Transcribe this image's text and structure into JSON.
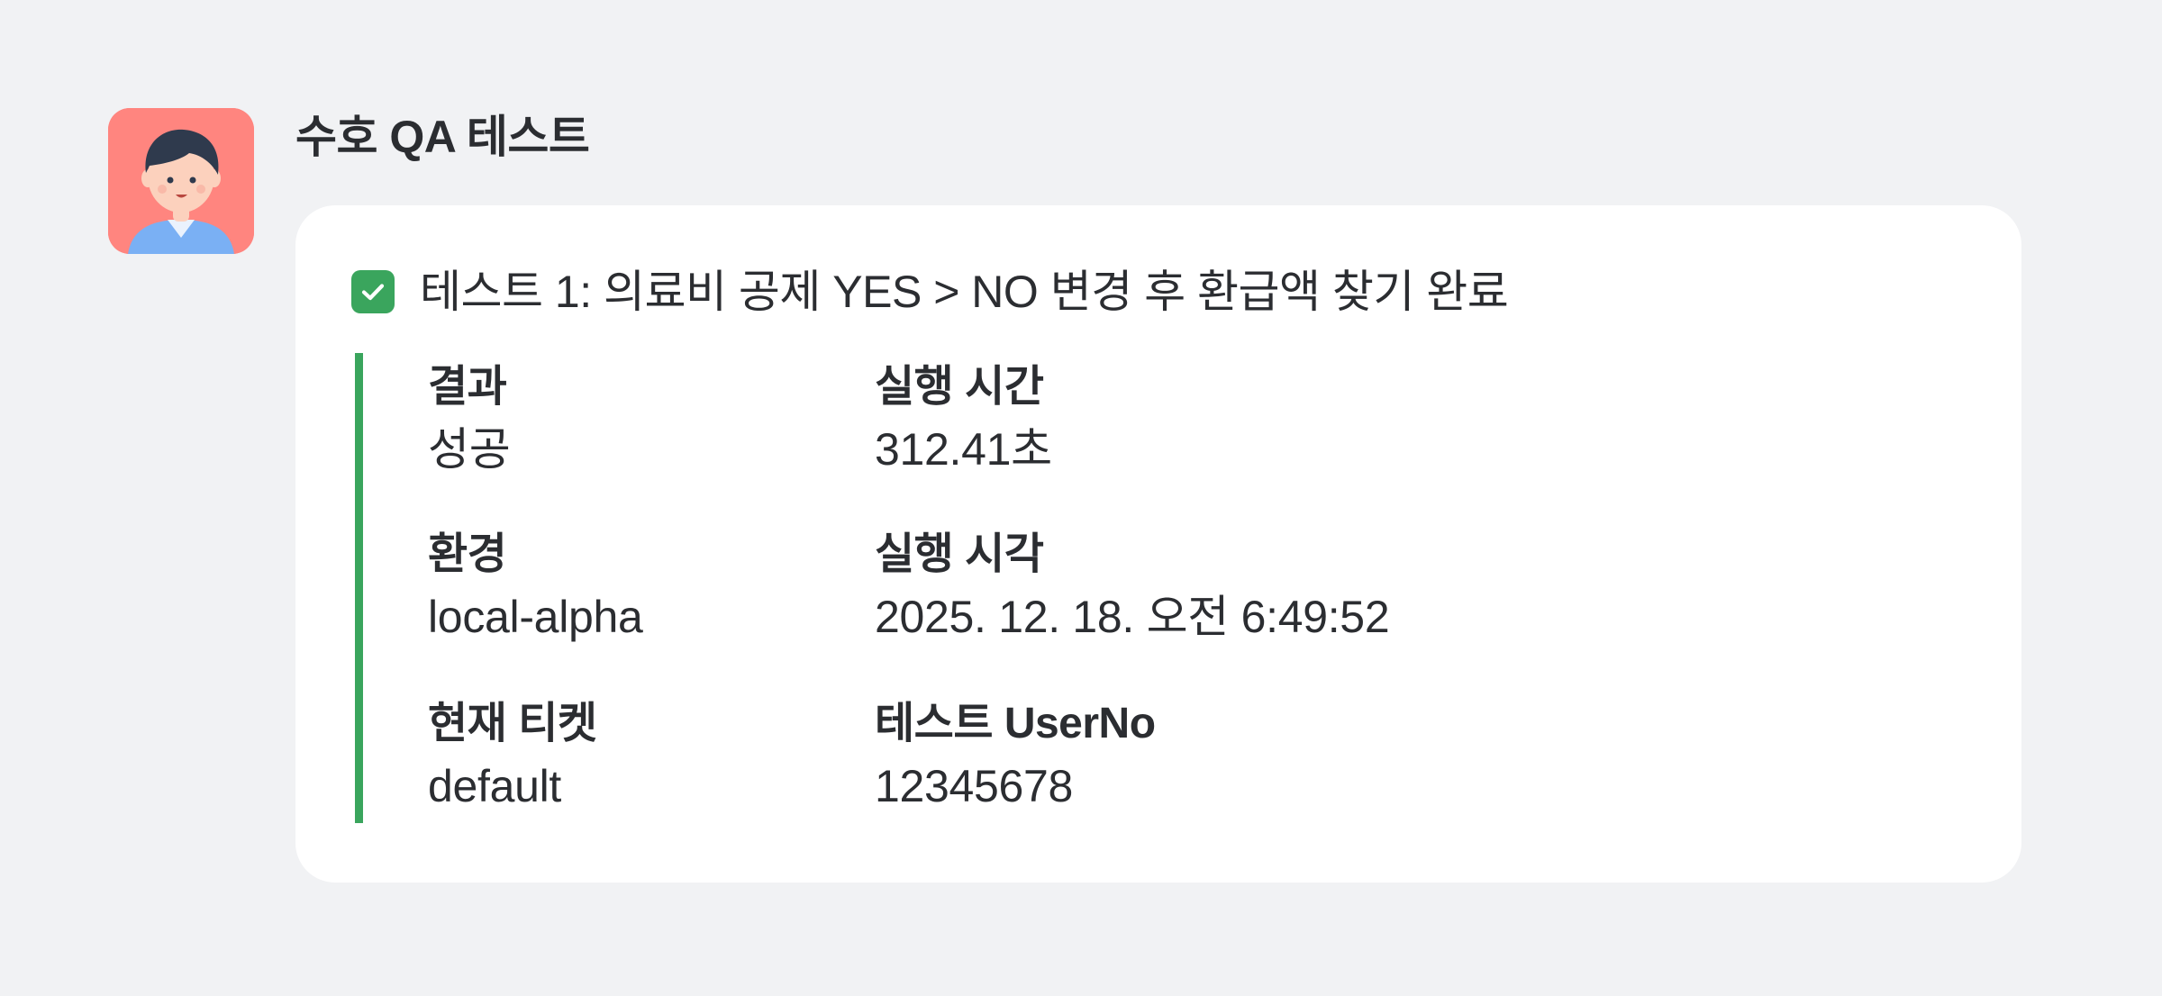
{
  "sender": {
    "name": "수호 QA 테스트",
    "avatar_icon": "person-avatar-icon"
  },
  "message": {
    "status_icon": "check-icon",
    "status_color": "#3aa55d",
    "title": "테스트 1: 의료비 공제 YES > NO 변경 후 환급액 찾기 완료",
    "fields": [
      {
        "label": "결과",
        "value": "성공"
      },
      {
        "label": "실행 시간",
        "value": "312.41초"
      },
      {
        "label": "환경",
        "value": "local-alpha"
      },
      {
        "label": "실행 시각",
        "value": "2025. 12. 18. 오전 6:49:52"
      },
      {
        "label": "현재 티켓",
        "value": "default"
      },
      {
        "label": "테스트 UserNo",
        "value": "12345678"
      }
    ]
  },
  "colors": {
    "background": "#f1f2f4",
    "card": "#ffffff",
    "accent": "#3aa55d",
    "avatar_bg": "#ff857f"
  }
}
